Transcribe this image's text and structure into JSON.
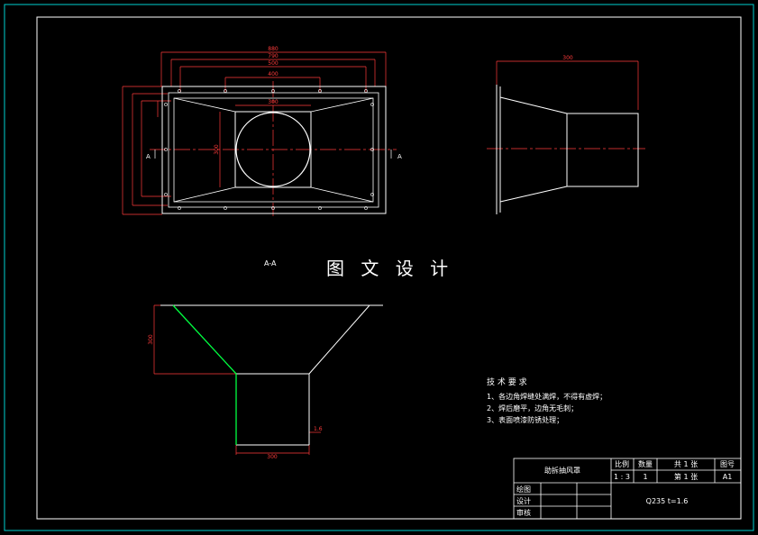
{
  "drawing": {
    "watermark": "图 文 设 计",
    "section_label": "A-A",
    "section_markers": [
      "A",
      "A"
    ],
    "colors": {
      "background": "#000000",
      "outline": "#ffffff",
      "dimension": "#ff3b3b",
      "center_line": "#ff3b3b",
      "frame": "#00cfcf",
      "weld_line": "#00ff40"
    },
    "top_view_dimensions": [
      "880",
      "790",
      "500",
      "400",
      "300",
      "300"
    ],
    "side_view_dimensions": [
      "300"
    ],
    "section_dimensions": [
      "300",
      "1.6",
      "300"
    ],
    "technical_requirements": {
      "heading": "技 术 要 求",
      "items": [
        "1、各边角焊缝处满焊，不得有虚焊；",
        "2、焊后磨平，边角无毛刺；",
        "3、表面喷漆防锈处理；"
      ]
    }
  },
  "title_block": {
    "part_name": "助拆抽风罩",
    "headers": [
      "比例",
      "数量",
      "共 1 张",
      "图号"
    ],
    "values": [
      "1 : 3",
      "1",
      "第 1 张",
      "A1"
    ],
    "roles": [
      "绘图",
      "设计",
      "审核"
    ],
    "material": "Q235  t=1.6"
  }
}
